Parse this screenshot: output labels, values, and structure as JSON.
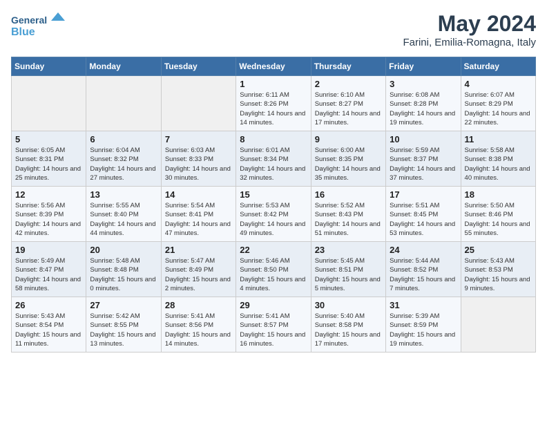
{
  "logo": {
    "line1": "General",
    "line2": "Blue"
  },
  "title": "May 2024",
  "location": "Farini, Emilia-Romagna, Italy",
  "weekdays": [
    "Sunday",
    "Monday",
    "Tuesday",
    "Wednesday",
    "Thursday",
    "Friday",
    "Saturday"
  ],
  "weeks": [
    [
      {
        "day": "",
        "info": ""
      },
      {
        "day": "",
        "info": ""
      },
      {
        "day": "",
        "info": ""
      },
      {
        "day": "1",
        "info": "Sunrise: 6:11 AM\nSunset: 8:26 PM\nDaylight: 14 hours\nand 14 minutes."
      },
      {
        "day": "2",
        "info": "Sunrise: 6:10 AM\nSunset: 8:27 PM\nDaylight: 14 hours\nand 17 minutes."
      },
      {
        "day": "3",
        "info": "Sunrise: 6:08 AM\nSunset: 8:28 PM\nDaylight: 14 hours\nand 19 minutes."
      },
      {
        "day": "4",
        "info": "Sunrise: 6:07 AM\nSunset: 8:29 PM\nDaylight: 14 hours\nand 22 minutes."
      }
    ],
    [
      {
        "day": "5",
        "info": "Sunrise: 6:05 AM\nSunset: 8:31 PM\nDaylight: 14 hours\nand 25 minutes."
      },
      {
        "day": "6",
        "info": "Sunrise: 6:04 AM\nSunset: 8:32 PM\nDaylight: 14 hours\nand 27 minutes."
      },
      {
        "day": "7",
        "info": "Sunrise: 6:03 AM\nSunset: 8:33 PM\nDaylight: 14 hours\nand 30 minutes."
      },
      {
        "day": "8",
        "info": "Sunrise: 6:01 AM\nSunset: 8:34 PM\nDaylight: 14 hours\nand 32 minutes."
      },
      {
        "day": "9",
        "info": "Sunrise: 6:00 AM\nSunset: 8:35 PM\nDaylight: 14 hours\nand 35 minutes."
      },
      {
        "day": "10",
        "info": "Sunrise: 5:59 AM\nSunset: 8:37 PM\nDaylight: 14 hours\nand 37 minutes."
      },
      {
        "day": "11",
        "info": "Sunrise: 5:58 AM\nSunset: 8:38 PM\nDaylight: 14 hours\nand 40 minutes."
      }
    ],
    [
      {
        "day": "12",
        "info": "Sunrise: 5:56 AM\nSunset: 8:39 PM\nDaylight: 14 hours\nand 42 minutes."
      },
      {
        "day": "13",
        "info": "Sunrise: 5:55 AM\nSunset: 8:40 PM\nDaylight: 14 hours\nand 44 minutes."
      },
      {
        "day": "14",
        "info": "Sunrise: 5:54 AM\nSunset: 8:41 PM\nDaylight: 14 hours\nand 47 minutes."
      },
      {
        "day": "15",
        "info": "Sunrise: 5:53 AM\nSunset: 8:42 PM\nDaylight: 14 hours\nand 49 minutes."
      },
      {
        "day": "16",
        "info": "Sunrise: 5:52 AM\nSunset: 8:43 PM\nDaylight: 14 hours\nand 51 minutes."
      },
      {
        "day": "17",
        "info": "Sunrise: 5:51 AM\nSunset: 8:45 PM\nDaylight: 14 hours\nand 53 minutes."
      },
      {
        "day": "18",
        "info": "Sunrise: 5:50 AM\nSunset: 8:46 PM\nDaylight: 14 hours\nand 55 minutes."
      }
    ],
    [
      {
        "day": "19",
        "info": "Sunrise: 5:49 AM\nSunset: 8:47 PM\nDaylight: 14 hours\nand 58 minutes."
      },
      {
        "day": "20",
        "info": "Sunrise: 5:48 AM\nSunset: 8:48 PM\nDaylight: 15 hours\nand 0 minutes."
      },
      {
        "day": "21",
        "info": "Sunrise: 5:47 AM\nSunset: 8:49 PM\nDaylight: 15 hours\nand 2 minutes."
      },
      {
        "day": "22",
        "info": "Sunrise: 5:46 AM\nSunset: 8:50 PM\nDaylight: 15 hours\nand 4 minutes."
      },
      {
        "day": "23",
        "info": "Sunrise: 5:45 AM\nSunset: 8:51 PM\nDaylight: 15 hours\nand 5 minutes."
      },
      {
        "day": "24",
        "info": "Sunrise: 5:44 AM\nSunset: 8:52 PM\nDaylight: 15 hours\nand 7 minutes."
      },
      {
        "day": "25",
        "info": "Sunrise: 5:43 AM\nSunset: 8:53 PM\nDaylight: 15 hours\nand 9 minutes."
      }
    ],
    [
      {
        "day": "26",
        "info": "Sunrise: 5:43 AM\nSunset: 8:54 PM\nDaylight: 15 hours\nand 11 minutes."
      },
      {
        "day": "27",
        "info": "Sunrise: 5:42 AM\nSunset: 8:55 PM\nDaylight: 15 hours\nand 13 minutes."
      },
      {
        "day": "28",
        "info": "Sunrise: 5:41 AM\nSunset: 8:56 PM\nDaylight: 15 hours\nand 14 minutes."
      },
      {
        "day": "29",
        "info": "Sunrise: 5:41 AM\nSunset: 8:57 PM\nDaylight: 15 hours\nand 16 minutes."
      },
      {
        "day": "30",
        "info": "Sunrise: 5:40 AM\nSunset: 8:58 PM\nDaylight: 15 hours\nand 17 minutes."
      },
      {
        "day": "31",
        "info": "Sunrise: 5:39 AM\nSunset: 8:59 PM\nDaylight: 15 hours\nand 19 minutes."
      },
      {
        "day": "",
        "info": ""
      }
    ]
  ]
}
